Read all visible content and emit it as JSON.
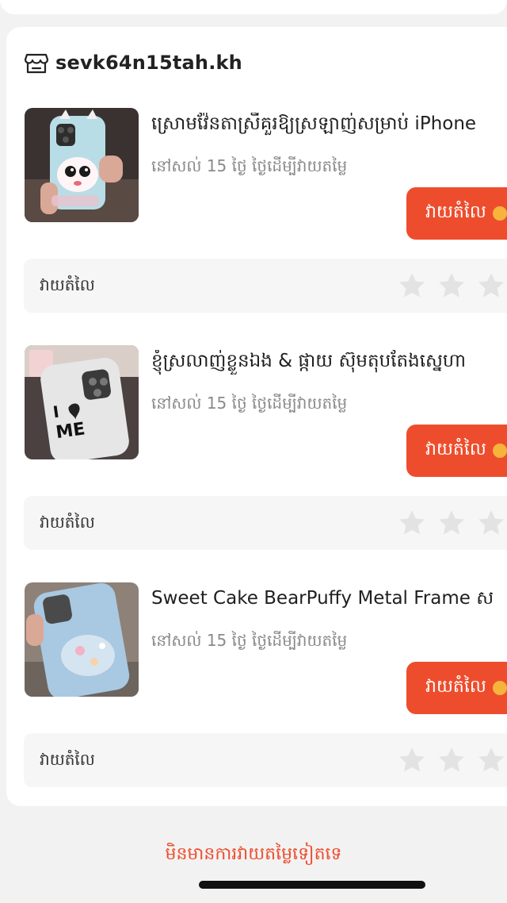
{
  "store": {
    "name": "sevk64n15tah.kh"
  },
  "items": [
    {
      "title": "ស្រោមវ៉ែនតាស្រីគួរឱ្យស្រឡាញ់សម្រាប់ iPhone",
      "subtitle": "នៅសល់ 15 ថ្ងៃ ថ្ងៃដើម្បីវាយតម្លៃ",
      "button_label": "វាយតំលៃ",
      "rating_label": "វាយតំលៃ"
    },
    {
      "title": "ខ្ញុំស្រលាញ់ខ្លួនឯង & ផ្កាយ ស៊ុមតុបតែងស្នេហា",
      "subtitle": "នៅសល់ 15 ថ្ងៃ ថ្ងៃដើម្បីវាយតម្លៃ",
      "button_label": "វាយតំលៃ",
      "rating_label": "វាយតំលៃ"
    },
    {
      "title": "Sweet Cake BearPuffy Metal Frame ស",
      "subtitle": "នៅសល់ 15 ថ្ងៃ ថ្ងៃដើម្បីវាយតម្លៃ",
      "button_label": "វាយតំលៃ",
      "rating_label": "វាយតំលៃ"
    }
  ],
  "footer": {
    "text": "មិនមានការវាយតម្លៃទៀតទេ"
  },
  "colors": {
    "accent": "#ee4d2d",
    "star_empty": "#e3e3e3",
    "coin": "#f6b43c"
  }
}
